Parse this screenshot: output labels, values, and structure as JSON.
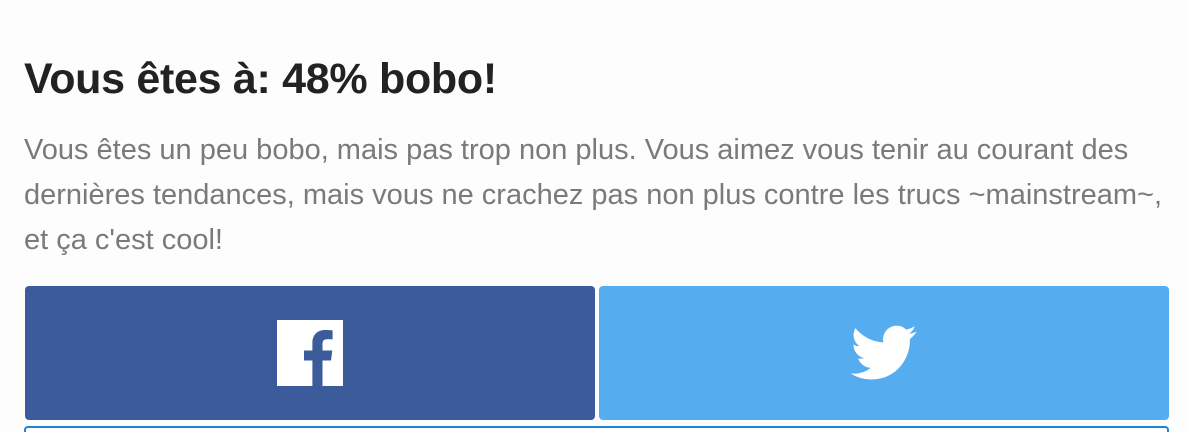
{
  "result": {
    "title": "Vous êtes à: 48% bobo!",
    "description": "Vous êtes un peu bobo, mais pas trop non plus. Vous aimez vous tenir au courant des dernières tendances, mais vous ne crachez pas non plus contre les trucs ~mainstream~, et ça c'est cool!"
  },
  "share": {
    "buttons": [
      {
        "network": "facebook",
        "icon": "facebook-icon",
        "color": "#3b5b9a"
      },
      {
        "network": "twitter",
        "icon": "twitter-icon",
        "color": "#55acee"
      }
    ]
  },
  "colors": {
    "title": "#222222",
    "text": "#7a7a7a",
    "facebook": "#3b5b9a",
    "twitter": "#55acee",
    "next_border": "#1f84d6"
  }
}
